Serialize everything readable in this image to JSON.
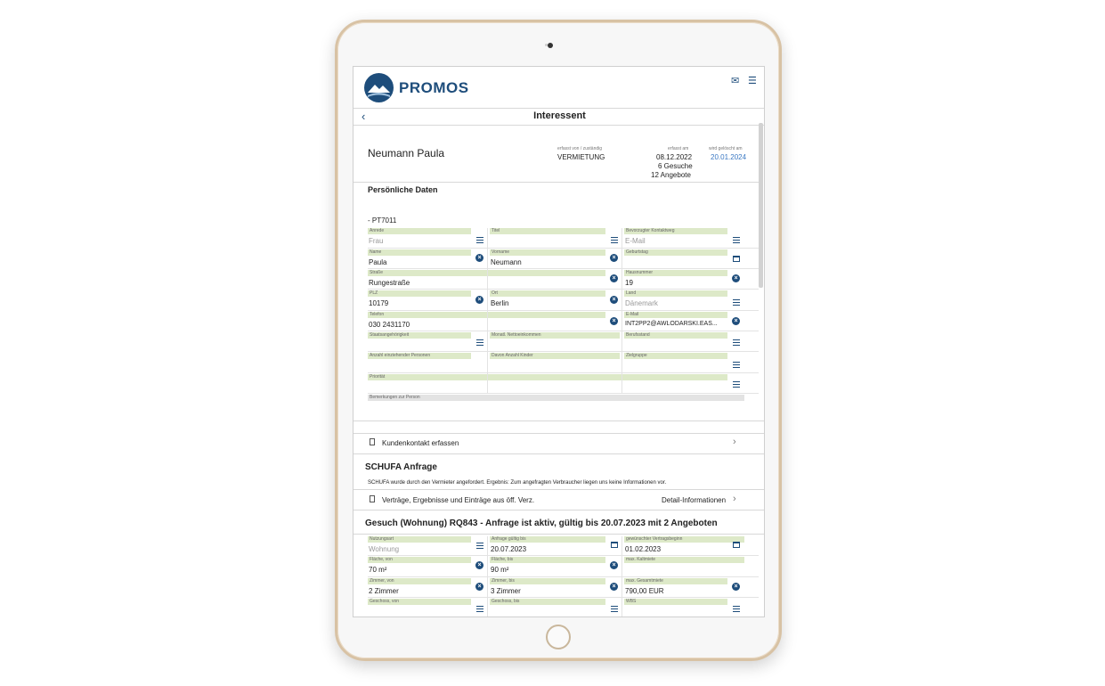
{
  "app": {
    "brand": "PROMOS",
    "page_title": "Interessent"
  },
  "header_icons": [
    "mail-icon",
    "menu-icon"
  ],
  "person": {
    "name": "Neumann Paula",
    "assigned_label": "erfasst von / zuständig",
    "assigned_value": "VERMIETUNG",
    "created_label": "erfasst am",
    "created_value": "08.12.2022",
    "searches": "6 Gesuche",
    "offers": "12 Angebote",
    "delete_label": "wird gelöscht am",
    "delete_value": "20.01.2024"
  },
  "personal": {
    "section_title": "Persönliche Daten",
    "ref": "- PT7011",
    "fields": {
      "anrede": {
        "label": "Anrede",
        "value": "Frau"
      },
      "titel": {
        "label": "Titel",
        "value": ""
      },
      "kontaktweg": {
        "label": "Bevorzugter Kontaktweg",
        "value": "E-Mail"
      },
      "name": {
        "label": "Name",
        "value": "Paula"
      },
      "vorname": {
        "label": "Vorname",
        "value": "Neumann"
      },
      "geburtstag": {
        "label": "Geburtstag",
        "value": ""
      },
      "strasse": {
        "label": "Straße",
        "value": "Rungestraße"
      },
      "hausnummer": {
        "label": "Hausnummer",
        "value": "19"
      },
      "plz": {
        "label": "PLZ",
        "value": "10179"
      },
      "ort": {
        "label": "Ort",
        "value": "Berlin"
      },
      "land": {
        "label": "Land",
        "value": "Dänemark"
      },
      "telefon": {
        "label": "Telefon",
        "value": "030 2431170"
      },
      "email": {
        "label": "E-Mail",
        "value": "INT2PP2@AWLODARSKI.EAS..."
      },
      "staat": {
        "label": "Staatsangehörigkeit",
        "value": ""
      },
      "netto": {
        "label": "Monatl. Nettoeinkommen",
        "value": ""
      },
      "beruf": {
        "label": "Berufsstand",
        "value": ""
      },
      "personen": {
        "label": "Anzahl einziehender Personen",
        "value": ""
      },
      "kinder": {
        "label": "Davon Anzahl Kinder",
        "value": ""
      },
      "zielgruppe": {
        "label": "Zielgruppe",
        "value": ""
      },
      "prioritaet": {
        "label": "Priorität",
        "value": ""
      },
      "bemerkungen": {
        "label": "Bemerkungen zur Person",
        "value": ""
      }
    }
  },
  "actions": {
    "kundenkontakt": "Kundenkontakt erfassen",
    "vertraege": "Verträge, Ergebnisse und Einträge aus öff. Verz.",
    "detail": "Detail-Informationen"
  },
  "schufa": {
    "title": "SCHUFA Anfrage",
    "text": "SCHUFA wurde durch den Vermieter angefordert. Ergebnis: Zum angefragten Verbraucher liegen uns keine Informationen vor."
  },
  "gesuch": {
    "title": "Gesuch (Wohnung) RQ843 - Anfrage ist aktiv, gültig bis 20.07.2023 mit 2 Angeboten",
    "fields": {
      "nutzungsart": {
        "label": "Nutzungsart",
        "value": "Wohnung"
      },
      "gueltig": {
        "label": "Anfrage gültig bis",
        "value": "20.07.2023"
      },
      "beginn": {
        "label": "gewünschter Vertragsbeginn",
        "value": "01.02.2023"
      },
      "flaeche_von": {
        "label": "Fläche, von",
        "value": "70 m²"
      },
      "flaeche_bis": {
        "label": "Fläche, bis",
        "value": "90 m²"
      },
      "kaltmiete": {
        "label": "max. Kaltmiete",
        "value": ""
      },
      "zimmer_von": {
        "label": "Zimmer, von",
        "value": "2 Zimmer"
      },
      "zimmer_bis": {
        "label": "Zimmer, bis",
        "value": "3 Zimmer"
      },
      "gesamtmiete": {
        "label": "max. Gesamtmiete",
        "value": "790,00  EUR"
      },
      "geschoss_von": {
        "label": "Geschoss, von",
        "value": ""
      },
      "geschoss_bis": {
        "label": "Geschoss, bis",
        "value": ""
      },
      "wbs": {
        "label": "WBS",
        "value": ""
      }
    }
  },
  "colors": {
    "brand": "#1e4d7b",
    "field_label_bg": "#dde9c8",
    "link": "#3a78c3"
  }
}
